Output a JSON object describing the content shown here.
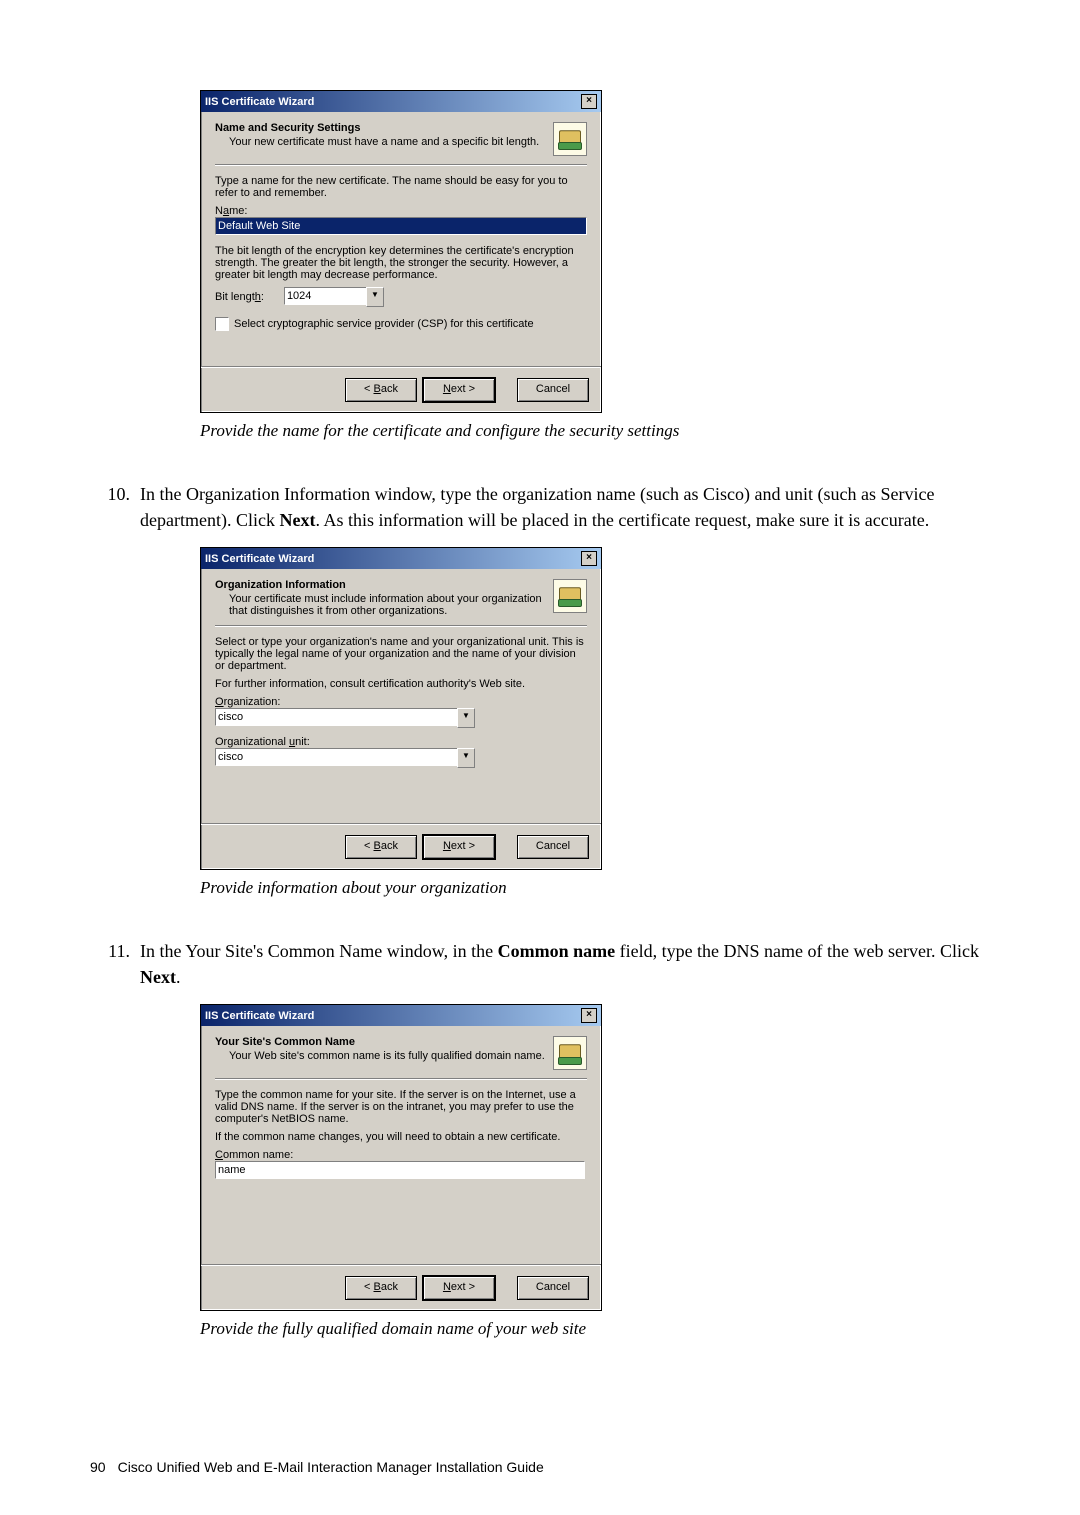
{
  "dialog1": {
    "window_title": "IIS Certificate Wizard",
    "heading": "Name and Security Settings",
    "subtitle": "Your new certificate must have a name and a specific bit length.",
    "instr1": "Type a name for the new certificate. The name should be easy for you to refer to and remember.",
    "name_label": "Name:",
    "name_value": "Default Web Site",
    "instr2": "The bit length of the encryption key determines the certificate's encryption strength. The greater the bit length, the stronger the security. However, a greater bit length may decrease performance.",
    "bitlen_label": "Bit length:",
    "bitlen_value": "1024",
    "csp_label": "Select cryptographic service provider (CSP) for this certificate",
    "back": "< Back",
    "next": "Next >",
    "cancel": "Cancel"
  },
  "caption1": "Provide the name for the certificate and configure the security settings",
  "step10": {
    "num": "10.",
    "t1": "In the Organization Information window, type the organization name (such as Cisco) and unit (such as Service department). Click ",
    "b1": "Next",
    "t2": ". As this information will be placed in the certificate request, make sure it is accurate."
  },
  "dialog2": {
    "window_title": "IIS Certificate Wizard",
    "heading": "Organization Information",
    "subtitle": "Your certificate must include information about your organization that distinguishes it from other organizations.",
    "instr1": "Select or type your organization's name and your organizational unit. This is typically the legal name of your organization and the name of your division or department.",
    "instr2": "For further information, consult certification authority's Web site.",
    "org_label": "Organization:",
    "org_value": "cisco",
    "ou_label": "Organizational unit:",
    "ou_value": "cisco",
    "back": "< Back",
    "next": "Next >",
    "cancel": "Cancel"
  },
  "caption2": "Provide information about your organization",
  "step11": {
    "num": "11.",
    "t1": "In the Your Site's Common Name window, in the ",
    "b1": "Common name",
    "t2": " field, type the DNS name of the web server. Click ",
    "b2": "Next",
    "t3": "."
  },
  "dialog3": {
    "window_title": "IIS Certificate Wizard",
    "heading": "Your Site's Common Name",
    "subtitle": "Your Web site's common name is its fully qualified domain name.",
    "instr1": "Type the common name for your site. If the server is on the Internet, use a valid DNS name. If the server is on the intranet, you may prefer to use the computer's NetBIOS name.",
    "instr2": "If the common name changes, you will need to obtain a new certificate.",
    "cn_label": "Common name:",
    "cn_value": "name",
    "back": "< Back",
    "next": "Next >",
    "cancel": "Cancel"
  },
  "caption3": "Provide the fully qualified domain name of your web site",
  "footer": {
    "page": "90",
    "title": "Cisco Unified Web and E-Mail Interaction Manager Installation Guide"
  }
}
